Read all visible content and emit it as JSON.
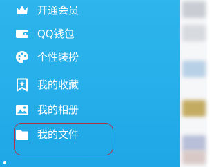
{
  "drawer": {
    "items": [
      {
        "label": "开通会员",
        "icon": "crown-icon"
      },
      {
        "label": "QQ钱包",
        "icon": "wallet-icon"
      },
      {
        "label": "个性装扮",
        "icon": "palette-icon"
      },
      {
        "label": "我的收藏",
        "icon": "bookmark-star-icon"
      },
      {
        "label": "我的相册",
        "icon": "photo-album-icon"
      },
      {
        "label": "我的文件",
        "icon": "folder-icon"
      }
    ],
    "highlighted_item": "我的文件"
  },
  "colors": {
    "drawer_background": "#27b0ea",
    "highlight_outline": "#b3314a",
    "text": "#ffffff"
  }
}
